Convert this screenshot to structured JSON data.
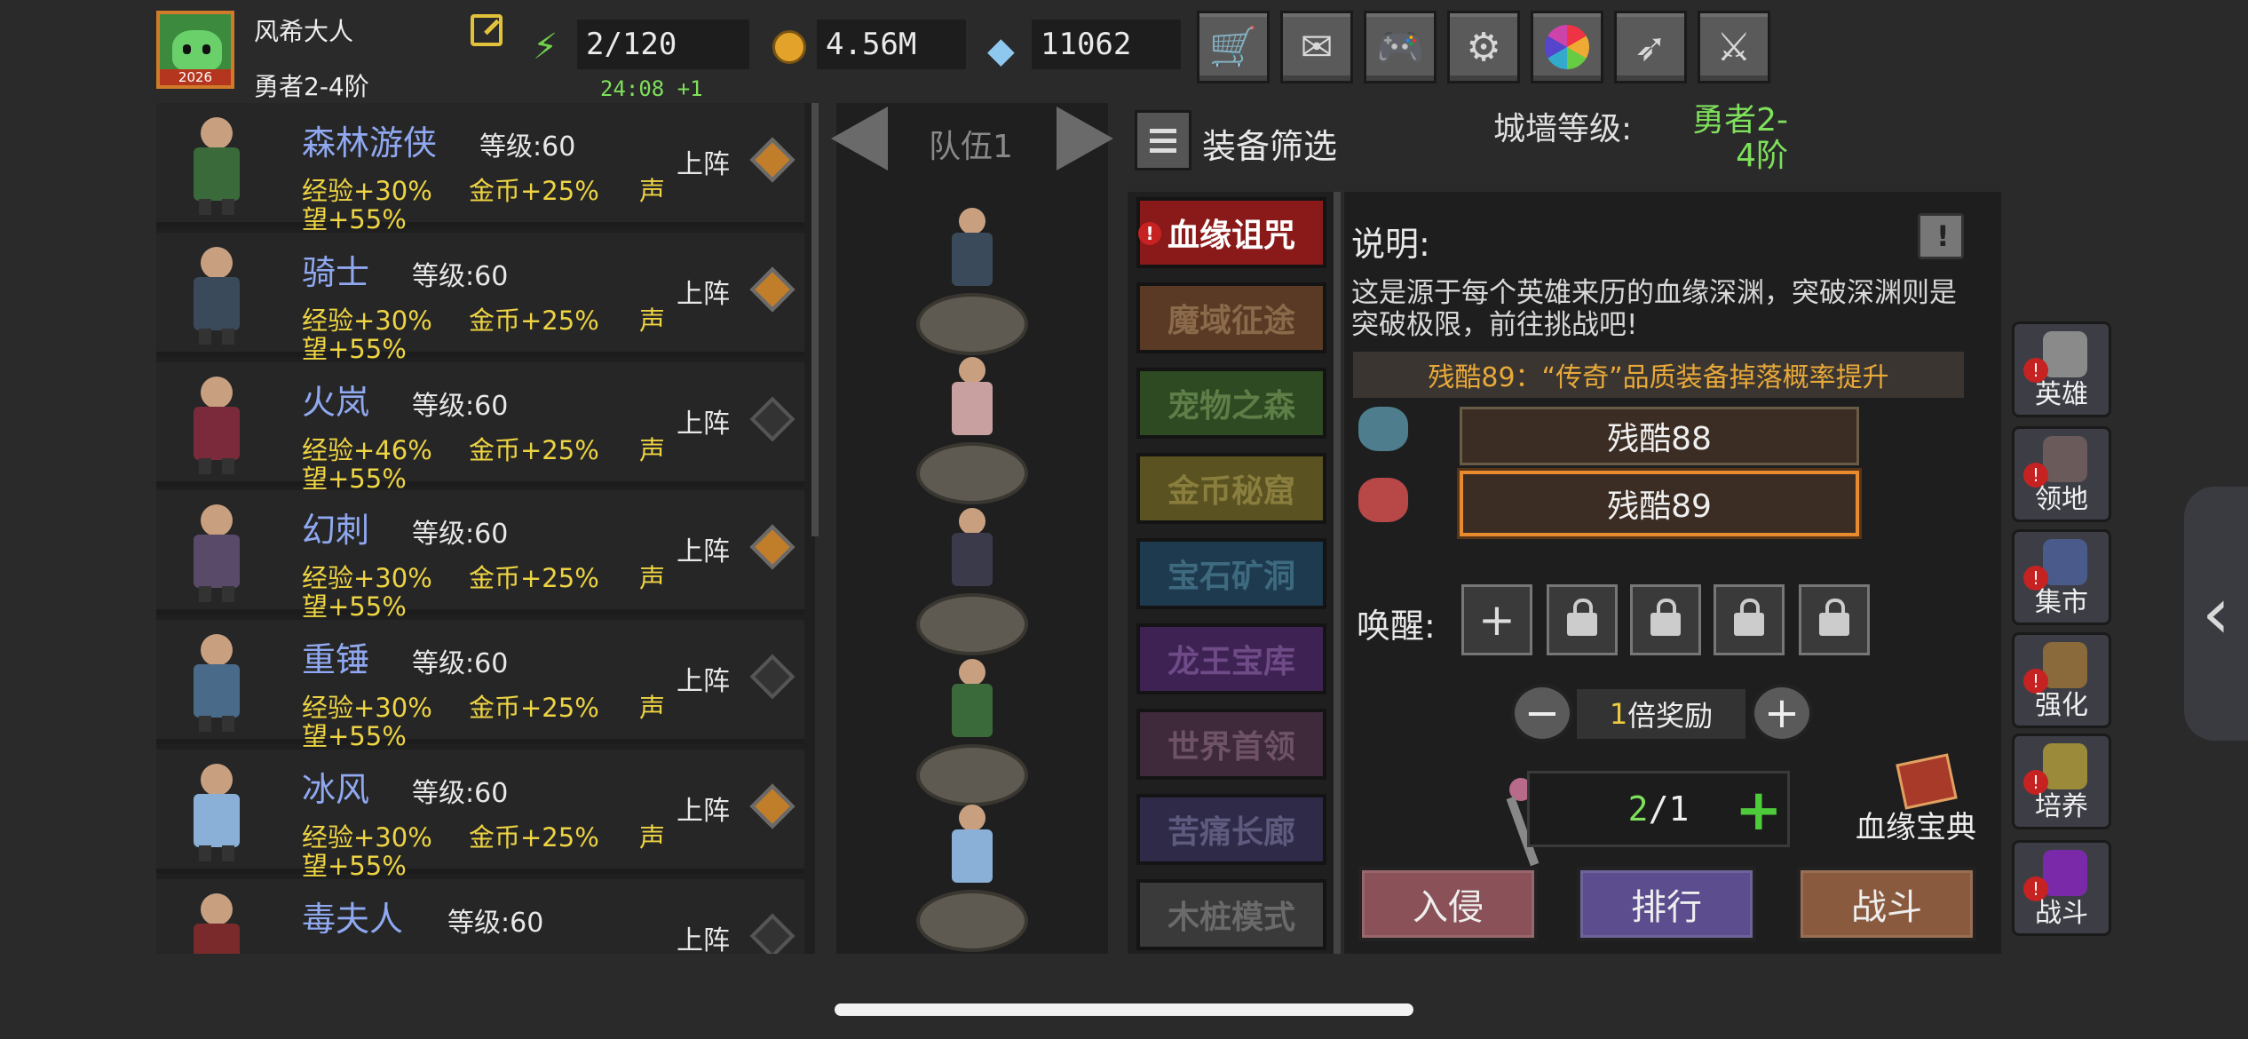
{
  "player": {
    "name": "风希大人",
    "rank": "勇者2-4阶",
    "avatar_year": "2026"
  },
  "resources": {
    "stamina": "2/120",
    "stamina_timer": "24:08 +1",
    "gold": "4.56M",
    "gems": "11062"
  },
  "top_buttons": [
    "cart-icon",
    "mail-icon",
    "gamepad-icon",
    "gear-icon",
    "color-wheel-icon",
    "feather-icon",
    "crossed-swords-icon"
  ],
  "hero_list": {
    "deploy_label": "上阵",
    "heroes": [
      {
        "name": "森林游侠",
        "level": "等级:60",
        "exp": "经验+30%",
        "gold": "金币+25%",
        "rep1": "声",
        "rep2": "望+55%",
        "on": true
      },
      {
        "name": "骑士",
        "level": "等级:60",
        "exp": "经验+30%",
        "gold": "金币+25%",
        "rep1": "声",
        "rep2": "望+55%",
        "on": true
      },
      {
        "name": "火岚",
        "level": "等级:60",
        "exp": "经验+46%",
        "gold": "金币+25%",
        "rep1": "声",
        "rep2": "望+55%",
        "on": false
      },
      {
        "name": "幻刺",
        "level": "等级:60",
        "exp": "经验+30%",
        "gold": "金币+25%",
        "rep1": "声",
        "rep2": "望+55%",
        "on": true
      },
      {
        "name": "重锤",
        "level": "等级:60",
        "exp": "经验+30%",
        "gold": "金币+25%",
        "rep1": "声",
        "rep2": "望+55%",
        "on": false
      },
      {
        "name": "冰风",
        "level": "等级:60",
        "exp": "经验+30%",
        "gold": "金币+25%",
        "rep1": "声",
        "rep2": "望+55%",
        "on": true
      },
      {
        "name": "毒夫人",
        "level": "等级:60",
        "exp": "",
        "gold": "",
        "rep1": "",
        "rep2": "",
        "on": false
      }
    ]
  },
  "team": {
    "label": "队伍1"
  },
  "filter": {
    "label": "装备筛选",
    "wall_label": "城墙等级:",
    "wall_value": "勇者2-4阶"
  },
  "dungeons": [
    {
      "label": "血缘诅咒",
      "bg": "#8a1a1a",
      "color": "#ffffff",
      "alert": true
    },
    {
      "label": "魔域征途",
      "bg": "#5a3a24",
      "color": "#8a6a4a",
      "alert": false
    },
    {
      "label": "宠物之森",
      "bg": "#2e4a22",
      "color": "#5e7e48",
      "alert": false
    },
    {
      "label": "金币秘窟",
      "bg": "#5a5220",
      "color": "#8a7e3e",
      "alert": false
    },
    {
      "label": "宝石矿洞",
      "bg": "#1e3a4e",
      "color": "#3e6a80",
      "alert": false
    },
    {
      "label": "龙王宝库",
      "bg": "#3e2254",
      "color": "#6e4a86",
      "alert": false
    },
    {
      "label": "世界首领",
      "bg": "#3e2a3a",
      "color": "#6e5266",
      "alert": false
    },
    {
      "label": "苦痛长廊",
      "bg": "#2e2a48",
      "color": "#5e5a7e",
      "alert": false
    },
    {
      "label": "木桩模式",
      "bg": "#3a3a3a",
      "color": "#6a6a6a",
      "alert": false
    }
  ],
  "info": {
    "title": "说明:",
    "description": "这是源于每个英雄来历的血缘深渊，突破深渊则是突破极限，前往挑战吧!",
    "bonus": "残酷89：“传奇”品质装备掉落概率提升",
    "difficulties": [
      "残酷88",
      "残酷89"
    ],
    "awaken_label": "唤醒:",
    "multiplier_num": "1",
    "multiplier_text": "倍奖励",
    "count": "2",
    "count_sep": "/1",
    "codex_label": "血缘宝典",
    "actions": [
      "入侵",
      "排行",
      "战斗"
    ]
  },
  "side_nav": [
    {
      "label": "英雄",
      "icon": "helmet-icon",
      "color": "#8a8a8a"
    },
    {
      "label": "领地",
      "icon": "castle-icon",
      "color": "#6a5a5a"
    },
    {
      "label": "集市",
      "icon": "market-icon",
      "color": "#4a5a8a"
    },
    {
      "label": "强化",
      "icon": "crest-icon",
      "color": "#8a6a3a"
    },
    {
      "label": "培养",
      "icon": "chalice-icon",
      "color": "#9a8a3a"
    },
    {
      "label": "战斗",
      "icon": "portal-icon",
      "color": "#7a2aa8"
    }
  ]
}
